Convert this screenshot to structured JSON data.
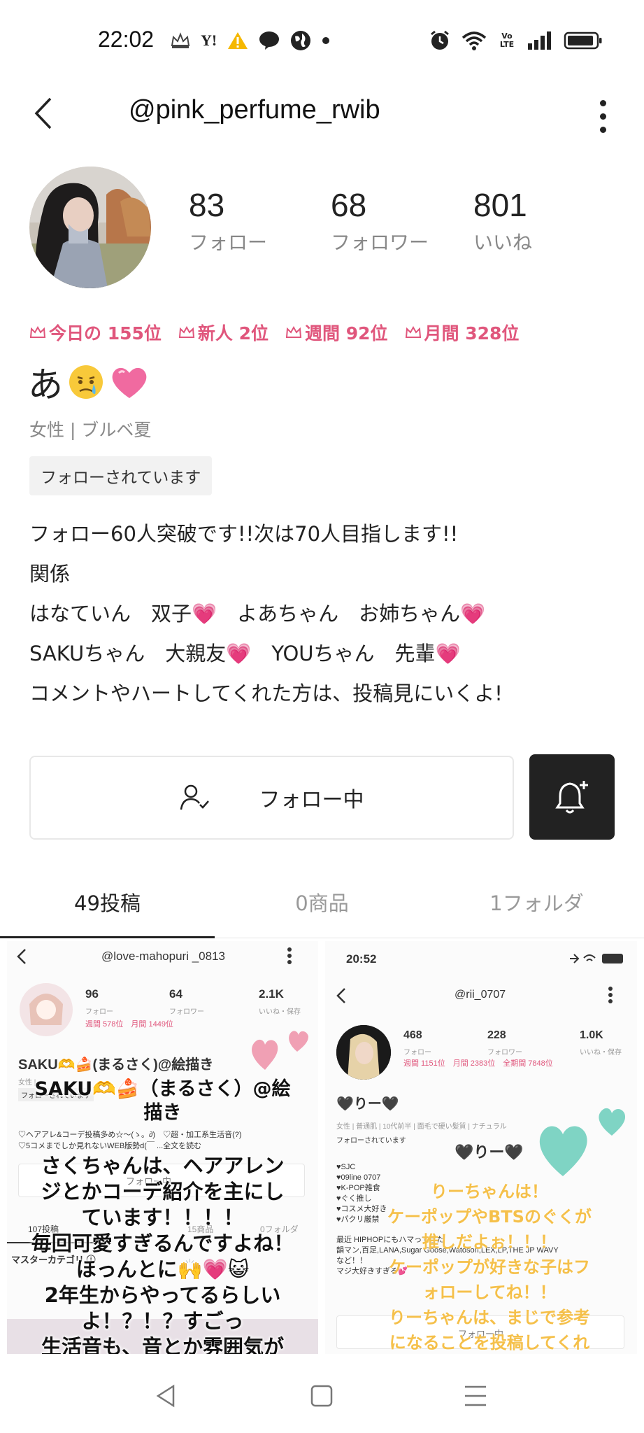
{
  "status_bar": {
    "time": "22:02",
    "left_icons": [
      "crown-app-icon",
      "yahoo-icon",
      "warning-icon",
      "line-icon",
      "globe-icon",
      "dot-icon"
    ],
    "right_icons": [
      "alarm-icon",
      "wifi-icon",
      "volte-icon",
      "signal-icon",
      "battery-icon"
    ],
    "yahoo_text": "Y!",
    "line_text": "LINE",
    "volte_text": "Vo LTE"
  },
  "nav": {
    "title": "@pink_perfume_rwib"
  },
  "profile": {
    "stats": [
      {
        "value": "83",
        "label": "フォロー"
      },
      {
        "value": "68",
        "label": "フォロワー"
      },
      {
        "value": "801",
        "label": "いいね"
      }
    ],
    "ranks": [
      {
        "label": "今日の 155位"
      },
      {
        "label": "新人 2位"
      },
      {
        "label": "週間 92位"
      },
      {
        "label": "月間 328位"
      }
    ],
    "display_name": "あ",
    "display_name_emojis": [
      "😢",
      "💗"
    ],
    "sub_info": "女性 | ブルベ夏",
    "follows_you": "フォローされています",
    "bio": [
      "フォロー60人突破です!!次は70人目指します!!",
      "関係",
      "はなていん　双子💗　よあちゃん　お姉ちゃん💗",
      "SAKUちゃん　大親友💗　YOUちゃん　先輩💗",
      "コメントやハートしてくれた方は、投稿見にいくよ!"
    ],
    "follow_button_label": "フォロー中"
  },
  "tabs": [
    {
      "label": "49投稿",
      "active": true
    },
    {
      "label": "0商品",
      "active": false
    },
    {
      "label": "1フォルダ",
      "active": false
    }
  ],
  "posts": {
    "left": {
      "handle": "@love-mahopuri _0813",
      "stats": [
        {
          "value": "96",
          "label": "フォロー"
        },
        {
          "value": "64",
          "label": "フォロワー"
        },
        {
          "value": "2.1K",
          "label": "いいね・保存"
        }
      ],
      "ranks": "週間 578位　月間 1449位",
      "name": "SAKU🫶🍰(まるさく)@絵描き",
      "sub": "女性 | ...",
      "follows_you": "フォローされています",
      "bio1": "♡ヘアアレ&コーデ投稿多め☆〜(ゝ。∂)　♡超・加工系生活音(?)",
      "bio2": "♡5コメまでしか見れないWEB版勢d(￣  ...全文を読む",
      "follow_label": "フォロー中",
      "tabs": [
        "107投稿",
        "15商品",
        "0フォルダ"
      ],
      "category": "マスターカテゴリ ⓘ",
      "overlay_lines": [
        "SAKU🫶🍰（まるさく）@絵",
        "描き",
        "さくちゃんは、ヘアアレン",
        "ジとかコーデ紹介を主にし",
        "ています！！！！",
        "毎回可愛すぎるんですよね！",
        "ほっんとに🙌💗😺",
        "2年生からやってるらしい",
        "よ！？！？すごっ",
        "生活音も、音とか雰囲気が"
      ]
    },
    "right": {
      "time": "20:52",
      "handle": "@rii_0707",
      "stats": [
        {
          "value": "468",
          "label": "フォロー"
        },
        {
          "value": "228",
          "label": "フォロワー"
        },
        {
          "value": "1.0K",
          "label": "いいね・保存"
        }
      ],
      "ranks": "週間 1151位　月間 2383位　全期間 7848位",
      "name": "🖤りー🖤",
      "sub": "女性 | 普通肌 | 10代前半 | 面毛で硬い髪質 | ナチュラル",
      "follows_you": "フォローされています",
      "bio": [
        "♥SJC",
        "♥09line 0707",
        "♥K-POP雑食",
        "♥ぐく推し",
        "♥コスメ大好き",
        "♥パクリ厳禁"
      ],
      "bio_extra": [
        "最近 HIPHOPにもハマってきた",
        "韻マン,百足,LANA,Sugar Goose,Watoson,LEX,LP,THE JP WAVY",
        "など！！",
        "マジ大好きすぎる💕"
      ],
      "follow_label": "フォロー中",
      "overlay_name": "🖤りー🖤",
      "overlay_lines": [
        "りーちゃんは！",
        "ケーポップやBTSのぐくが",
        "推しだよぉ！！！",
        "ケーポップが好きな子はフ",
        "ォローしてね！！",
        "りーちゃんは、まじで参考",
        "になることを投稿してくれ"
      ]
    }
  },
  "bottom_nav": [
    "back-triangle-icon",
    "home-square-icon",
    "menu-lines-icon"
  ],
  "colors": {
    "accent_pink": "#e0567c",
    "dark": "#222222",
    "grey_text": "#888888",
    "teal_heart": "#7fd4c4",
    "pink_heart": "#f0a0b4",
    "overlay_yellow": "#f5c04a"
  }
}
